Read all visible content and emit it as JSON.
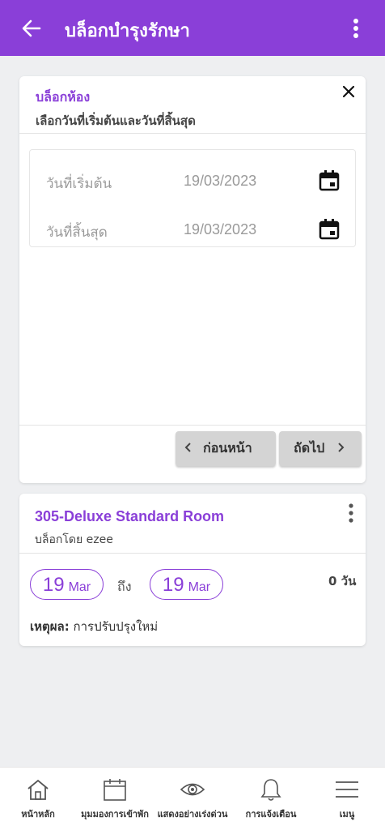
{
  "appbar": {
    "title": "บล็อกบำรุงรักษา",
    "back_icon": "arrow-left-icon",
    "more_icon": "more-vertical-icon"
  },
  "filter": {
    "title": "บล็อกห้อง",
    "subtitle": "เลือกวันที่เริ่มต้นและวันที่สิ้นสุด",
    "start_label": "วันที่เริ่มต้น",
    "start_value": "19/03/2023",
    "end_label": "วันที่สิ้นสุด",
    "end_value": "19/03/2023",
    "prev_label": "ก่อนหน้า",
    "next_label": "ถัดไป"
  },
  "room": {
    "name": "305-Deluxe Standard Room",
    "blocked_by": "บล็อกโดย ezee",
    "from_day": "19",
    "from_month": "Mar",
    "to_word": "ถึง",
    "to_day": "19",
    "to_month": "Mar",
    "days": "0 วัน",
    "reason_label": "เหตุผล:",
    "reason_value": " การปรับปรุงใหม่"
  },
  "nav": [
    {
      "label": "หน้าหลัก",
      "icon": "home-icon"
    },
    {
      "label": "มุมมองการเข้าพัก",
      "icon": "calendar-icon"
    },
    {
      "label": "แสดงอย่างเร่งด่วน",
      "icon": "eye-icon"
    },
    {
      "label": "การแจ้งเตือน",
      "icon": "bell-icon"
    },
    {
      "label": "เมนู",
      "icon": "menu-icon"
    }
  ],
  "colors": {
    "primary": "#8a3fd8",
    "background": "#eeeff1"
  }
}
